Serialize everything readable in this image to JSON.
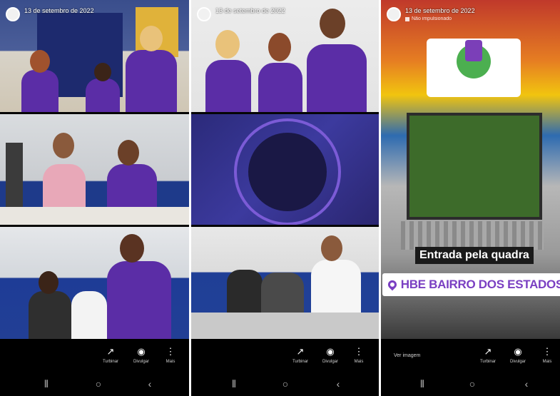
{
  "panels": [
    {
      "header": {
        "date": "13 de setembro de 2022",
        "sub": ""
      },
      "actions": [
        {
          "icon": "trend-icon",
          "glyph": "↗",
          "label": "Turbinar"
        },
        {
          "icon": "target-icon",
          "glyph": "◉",
          "label": "Divulgar"
        },
        {
          "icon": "more-icon",
          "glyph": "⋮",
          "label": "Mais"
        }
      ]
    },
    {
      "header": {
        "date": "13 de setembro de 2022",
        "sub": ""
      },
      "actions": [
        {
          "icon": "trend-icon",
          "glyph": "↗",
          "label": "Turbinar"
        },
        {
          "icon": "target-icon",
          "glyph": "◉",
          "label": "Divulgar"
        },
        {
          "icon": "more-icon",
          "glyph": "⋮",
          "label": "Mais"
        }
      ]
    },
    {
      "header": {
        "date": "13 de setembro de 2022",
        "sub": "Não impulsionado"
      },
      "ver_imagem": "Ver imagem",
      "caption": "Entrada pela quadra",
      "location": "HBE BAIRRO DOS ESTADOS",
      "actions": [
        {
          "icon": "trend-icon",
          "glyph": "↗",
          "label": "Turbinar"
        },
        {
          "icon": "target-icon",
          "glyph": "◉",
          "label": "Divulgar"
        },
        {
          "icon": "more-icon",
          "glyph": "⋮",
          "label": "Mais"
        }
      ]
    }
  ],
  "nav": {
    "recents": "⦀",
    "home": "○",
    "back": "‹"
  },
  "colors": {
    "purple": "#5b2da6",
    "location_text": "#7a3fc2",
    "bar": "#000000"
  }
}
